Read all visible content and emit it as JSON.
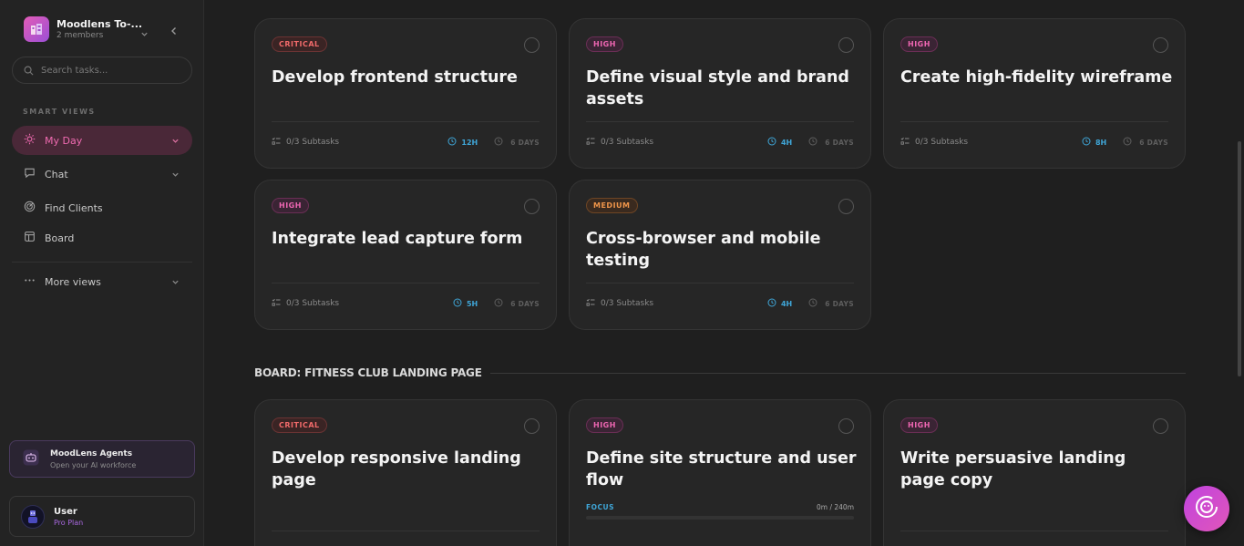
{
  "workspace": {
    "name": "Moodlens To-...",
    "members": "2 members"
  },
  "search": {
    "placeholder": "Search tasks..."
  },
  "sidebar": {
    "section_label": "SMART VIEWS",
    "items": [
      {
        "label": "My Day"
      },
      {
        "label": "Chat"
      },
      {
        "label": "Find Clients"
      },
      {
        "label": "Board"
      },
      {
        "label": "More views"
      }
    ]
  },
  "agents": {
    "title": "MoodLens Agents",
    "subtitle": "Open your AI workforce"
  },
  "user": {
    "name": "User",
    "plan": "Pro Plan"
  },
  "colors": {
    "accent": "#ef6ab0",
    "estimate": "#3fa6d8",
    "critical": "#f06a6a",
    "high": "#ee66b2",
    "medium": "#f0954a"
  },
  "cards": [
    {
      "priority": "CRITICAL",
      "title": "Develop frontend structure",
      "subtasks": "0/3 Subtasks",
      "estimate": "12H",
      "due": "6 DAYS"
    },
    {
      "priority": "HIGH",
      "title": "Define visual style and brand assets",
      "subtasks": "0/3 Subtasks",
      "estimate": "4H",
      "due": "6 DAYS"
    },
    {
      "priority": "HIGH",
      "title": "Create high-fidelity wireframe",
      "subtasks": "0/3 Subtasks",
      "estimate": "8H",
      "due": "6 DAYS"
    },
    {
      "priority": "HIGH",
      "title": "Integrate lead capture form",
      "subtasks": "0/3 Subtasks",
      "estimate": "5H",
      "due": "6 DAYS"
    },
    {
      "priority": "MEDIUM",
      "title": "Cross-browser and mobile testing",
      "subtasks": "0/3 Subtasks",
      "estimate": "4H",
      "due": "6 DAYS"
    }
  ],
  "board2": {
    "title": "BOARD: FITNESS CLUB LANDING PAGE",
    "cards": [
      {
        "priority": "CRITICAL",
        "title": "Develop responsive landing page"
      },
      {
        "priority": "HIGH",
        "title": "Define site structure and user flow",
        "focus_label": "FOCUS",
        "focus_time": "0m / 240m",
        "focus_progress": 0
      },
      {
        "priority": "HIGH",
        "title": "Write persuasive landing page copy"
      }
    ]
  }
}
